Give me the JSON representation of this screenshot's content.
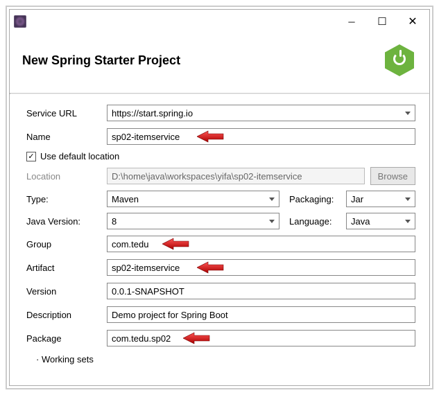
{
  "window": {
    "title": "New Spring Starter Project"
  },
  "form": {
    "serviceUrl": {
      "label": "Service URL",
      "value": "https://start.spring.io"
    },
    "name": {
      "label": "Name",
      "value": "sp02-itemservice"
    },
    "useDefault": {
      "label": "Use default location",
      "checked": "✓"
    },
    "location": {
      "label": "Location",
      "value": "D:\\home\\java\\workspaces\\yifa\\sp02-itemservice",
      "browse": "Browse"
    },
    "type": {
      "label": "Type:",
      "value": "Maven"
    },
    "packaging": {
      "label": "Packaging:",
      "value": "Jar"
    },
    "javaVersion": {
      "label": "Java Version:",
      "value": "8"
    },
    "language": {
      "label": "Language:",
      "value": "Java"
    },
    "group": {
      "label": "Group",
      "value": "com.tedu"
    },
    "artifact": {
      "label": "Artifact",
      "value": "sp02-itemservice"
    },
    "version": {
      "label": "Version",
      "value": "0.0.1-SNAPSHOT"
    },
    "description": {
      "label": "Description",
      "value": "Demo project for Spring Boot"
    },
    "package": {
      "label": "Package",
      "value": "com.tedu.sp02"
    },
    "workingSets": "Working sets"
  },
  "colors": {
    "springGreen": "#6db33f",
    "arrowRed": "#d40000"
  }
}
